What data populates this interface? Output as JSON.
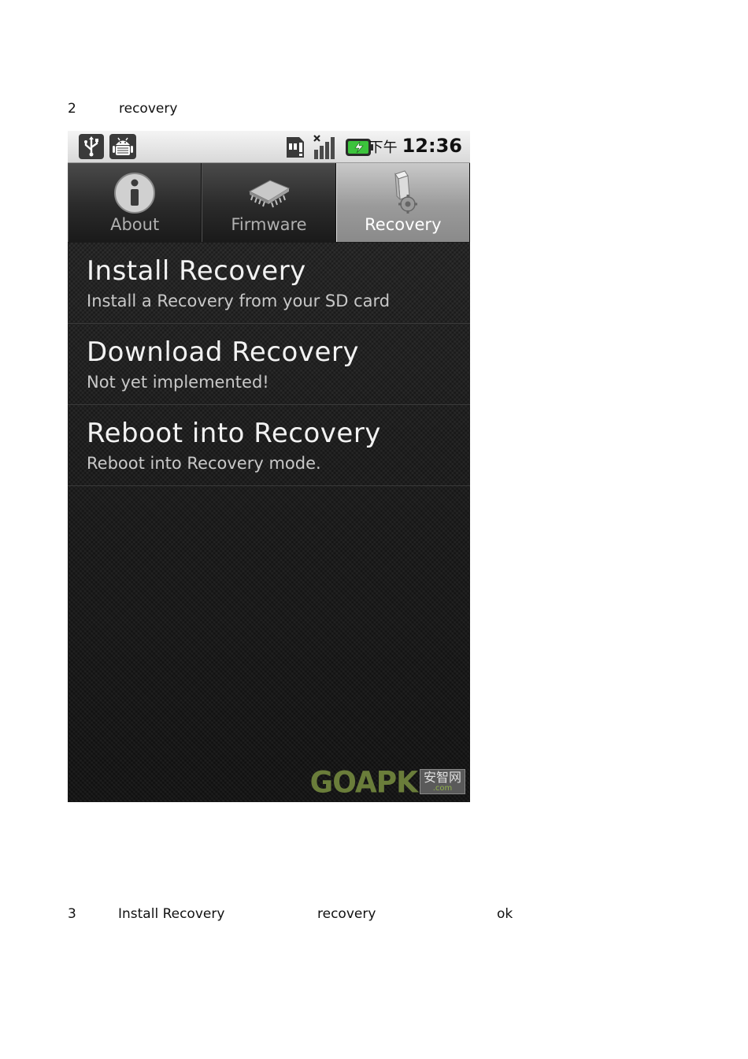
{
  "doc": {
    "step2_num": "2",
    "step2_text": "recovery",
    "step3_num": "3",
    "step3_a": "Install Recovery",
    "step3_b": "recovery",
    "step3_c": "ok"
  },
  "status_bar": {
    "icons": [
      "usb-icon",
      "android-debug-icon",
      "sd-card-warning-icon",
      "signal-icon",
      "battery-charging-icon"
    ],
    "ampm": "下午",
    "time": "12:36"
  },
  "tabs": [
    {
      "label": "About",
      "icon": "info-icon",
      "active": false
    },
    {
      "label": "Firmware",
      "icon": "chip-icon",
      "active": false
    },
    {
      "label": "Recovery",
      "icon": "recovery-icon",
      "active": true
    }
  ],
  "list": [
    {
      "title": "Install Recovery",
      "subtitle": "Install a Recovery from your SD card"
    },
    {
      "title": "Download Recovery",
      "subtitle": "Not yet implemented!"
    },
    {
      "title": "Reboot into Recovery",
      "subtitle": "Reboot into Recovery mode."
    }
  ],
  "watermark": {
    "text": "GOAPK",
    "badge": "安智网",
    "badge_sub": ".com"
  },
  "colors": {
    "active_tab": "#9a9a9a",
    "list_bg": "#1c1c1c",
    "watermark_green": "#6a7d3a"
  }
}
